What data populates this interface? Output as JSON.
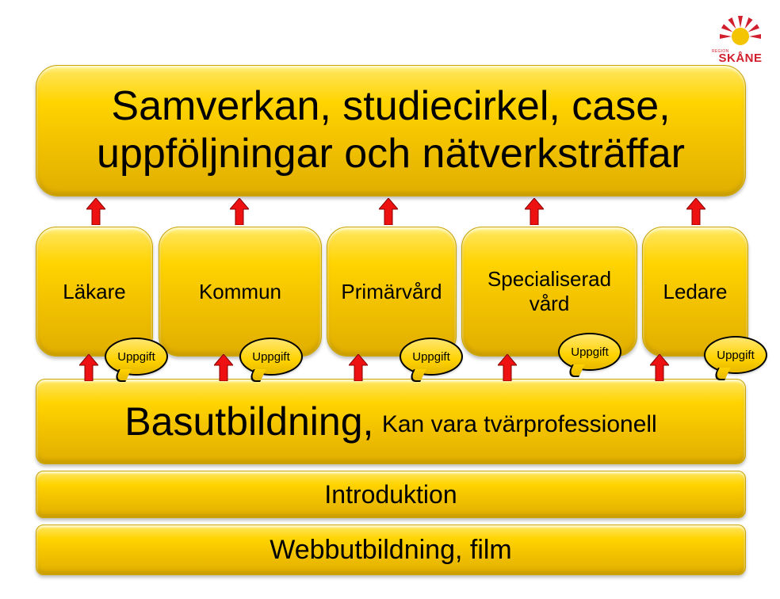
{
  "logo": {
    "mini": "REGION",
    "text": "SKÅNE"
  },
  "top": "Samverkan, studiecirkel, case, uppföljningar och nätverksträffar",
  "roles": [
    "Läkare",
    "Kommun",
    "Primärvård",
    "Specialiserad vård",
    "Ledare"
  ],
  "bubble_label": "Uppgift",
  "base": {
    "big": "Basutbildning,",
    "small": "Kan vara tvärprofessionell"
  },
  "intro": "Introduktion",
  "webb": "Webbutbildning, film"
}
